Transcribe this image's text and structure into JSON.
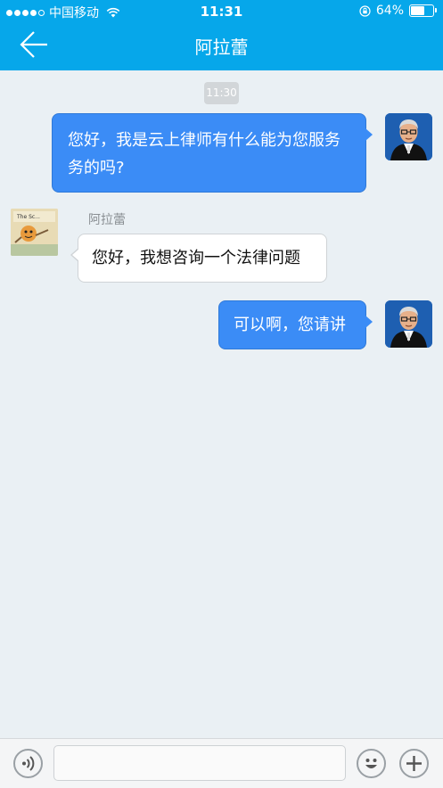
{
  "status_bar": {
    "signal_dots": 5,
    "signal_filled": 4,
    "carrier": "中国移动",
    "time": "11:31",
    "battery_text": "64%",
    "battery_level": 0.64,
    "icons": [
      "wifi-icon",
      "rotation-lock-icon",
      "battery-icon"
    ]
  },
  "header": {
    "title": "阿拉蕾",
    "back_icon": "back-arrow-icon",
    "background": "#06a7ea"
  },
  "chat": {
    "timestamp": "11:30",
    "messages": [
      {
        "direction": "out",
        "text_line1": "您好，我是云上律师有什么能为您服务",
        "text_line2": "务的吗?",
        "avatar": "lawyer-avatar"
      },
      {
        "direction": "in",
        "sender": "阿拉蕾",
        "text": "您好，我想咨询一个法律问题",
        "avatar": "cartoon-avatar"
      },
      {
        "direction": "out",
        "text": "可以啊，您请讲",
        "avatar": "lawyer-avatar"
      }
    ]
  },
  "input_bar": {
    "voice_icon": "voice-icon",
    "placeholder": "",
    "emoji_icon": "emoji-icon",
    "plus_icon": "plus-icon"
  },
  "colors": {
    "outgoing_bubble": "#3b8cf6",
    "incoming_bubble": "#ffffff",
    "chat_background": "#eaf0f4"
  }
}
